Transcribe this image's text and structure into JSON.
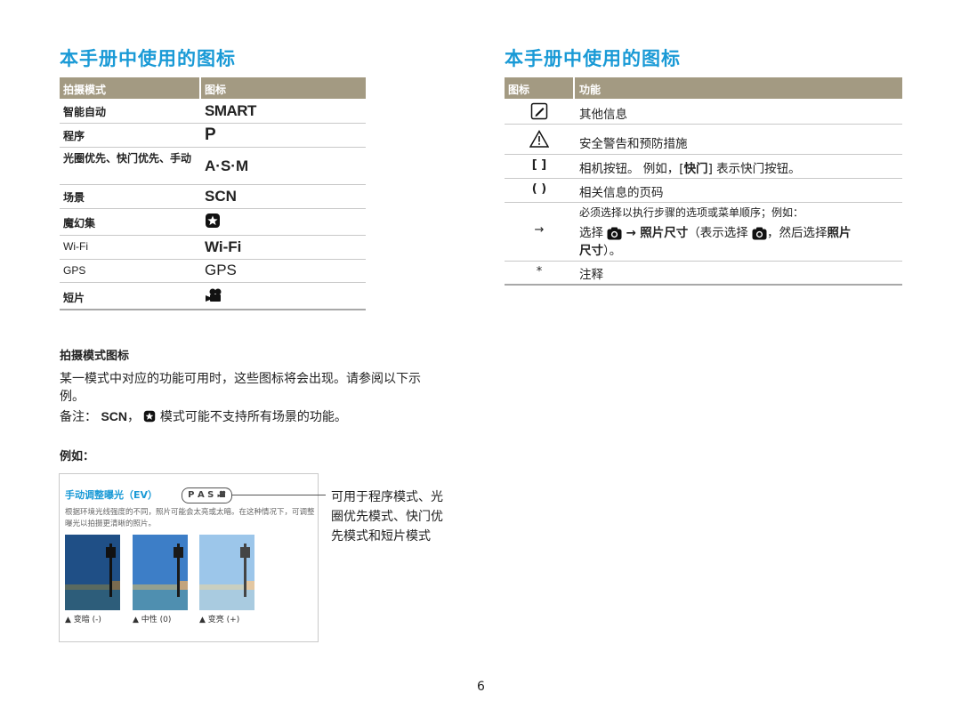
{
  "left": {
    "title": "本手册中使用的图标",
    "table": {
      "headers": [
        "拍摄模式",
        "图标"
      ],
      "rows": [
        {
          "mode": "智能自动",
          "icon_text": "SMART"
        },
        {
          "mode": "程序",
          "icon_text": "P"
        },
        {
          "mode": "光圈优先、快门优先、手动",
          "icon_text": "A·S·M"
        },
        {
          "mode": "场景",
          "icon_text": "SCN"
        },
        {
          "mode": "魔幻集",
          "icon_name": "magic-star-icon"
        },
        {
          "mode": "Wi-Fi",
          "icon_text": "Wi-Fi"
        },
        {
          "mode": "GPS",
          "icon_text": "GPS"
        },
        {
          "mode": "短片",
          "icon_name": "movie-camera-icon"
        }
      ]
    },
    "section_heading": "拍摄模式图标",
    "para1": "某一模式中对应的功能可用时，这些图标将会出现。请参阅以下示例。",
    "note_prefix": "备注：",
    "note_scn": "SCN",
    "note_suffix": "模式可能不支持所有场景的功能。",
    "example_label": "例如：",
    "example": {
      "title": "手动调整曝光（EV）",
      "badge": "P A S",
      "text": "根据环境光线强度的不同，照片可能会太亮或太暗。在这种情况下，可调整曝光以拍摄更清晰的照片。",
      "captions": [
        "▲ 变暗 (-)",
        "▲ 中性 (0)",
        "▲ 变亮 (+)"
      ],
      "callout": "可用于程序模式、光圈优先模式、快门优先模式和短片模式"
    }
  },
  "right": {
    "title": "本手册中使用的图标",
    "table": {
      "headers": [
        "图标",
        "功能"
      ],
      "rows": [
        {
          "icon_name": "note-pencil-icon",
          "desc": "其他信息"
        },
        {
          "icon_name": "warning-triangle-icon",
          "desc": "安全警告和预防措施"
        },
        {
          "icon_text": "[ ]",
          "desc_pre": "相机按钮。 例如，[",
          "desc_bold": "快门",
          "desc_post": "] 表示快门按钮。"
        },
        {
          "icon_text": "( )",
          "desc": "相关信息的页码"
        },
        {
          "icon_text": "→",
          "line1": "必须选择以执行步骤的选项或菜单顺序；例如：",
          "line2_a": "选择",
          "line2_b": "→",
          "line2_c": "照片尺寸",
          "line2_d": "（表示选择",
          "line2_e": "，然后选择",
          "line2_f": "照片",
          "line3_a": "尺寸",
          "line3_b": "）。"
        },
        {
          "icon_text": "*",
          "desc": "注释"
        }
      ]
    }
  },
  "page_number": "6",
  "colors": {
    "accent": "#1a9ad6",
    "header_bg": "#a39a82"
  }
}
